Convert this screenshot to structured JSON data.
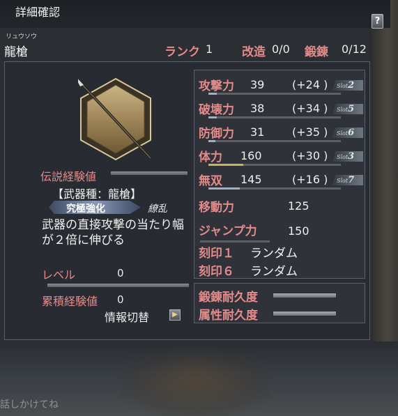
{
  "window": {
    "title": "詳細確認",
    "help_label": "?"
  },
  "weapon": {
    "furigana": "リュウソウ",
    "name": "龍槍",
    "rank_label": "ランク",
    "rank_value": "1",
    "kaizo_label": "改造",
    "kaizo_value": "0/0",
    "tanren_label": "鍛錬",
    "tanren_value": "0/12"
  },
  "left": {
    "legend_label": "伝説経験値",
    "legend_progress": 0,
    "weapon_type": "【武器種：龍槍】",
    "skill_label": "究極強化",
    "skill_sub": "繚乱",
    "skill_desc": "武器の直接攻撃の当たり幅が２倍に伸びる",
    "level_label": "レベル",
    "level_value": "0",
    "level_progress": 0,
    "exp_label": "累積経験値",
    "exp_value": "0",
    "info_toggle": "情報切替"
  },
  "stats": [
    {
      "label": "攻撃力",
      "value": "39",
      "bonus": "(+24 )",
      "slot_prefix": "Slot",
      "slot_num": "2",
      "bar_color": "#9fb0c4"
    },
    {
      "label": "破壊力",
      "value": "38",
      "bonus": "(+34 )",
      "slot_prefix": "Slot",
      "slot_num": "5",
      "bar_color": "#9fb0c4"
    },
    {
      "label": "防御力",
      "value": "31",
      "bonus": "(+35 )",
      "slot_prefix": "Slot",
      "slot_num": "6",
      "bar_color": "#9fb0c4"
    },
    {
      "label": "体力",
      "value": "160",
      "bonus": "(+30 )",
      "slot_prefix": "Slot",
      "slot_num": "3",
      "bar_color": "#c9b25a"
    },
    {
      "label": "無双",
      "value": "145",
      "bonus": "(+16 )",
      "slot_prefix": "Slot",
      "slot_num": "7",
      "bar_color": "#9fb0c4"
    }
  ],
  "move": {
    "label": "移動力",
    "value": "125"
  },
  "jump": {
    "label": "ジャンプ力",
    "value": "150"
  },
  "seals": [
    {
      "label": "刻印１",
      "value": "ランダム"
    },
    {
      "label": "刻印６",
      "value": "ランダム"
    }
  ],
  "durability": [
    {
      "label": "鍛錬耐久度"
    },
    {
      "label": "属性耐久度"
    }
  ],
  "background": {
    "bottom_text": "話しかけてね"
  },
  "colors": {
    "label_red": "#e58a8a",
    "panel_border": "#5b6068",
    "hex_gold": "#b09a6a"
  }
}
